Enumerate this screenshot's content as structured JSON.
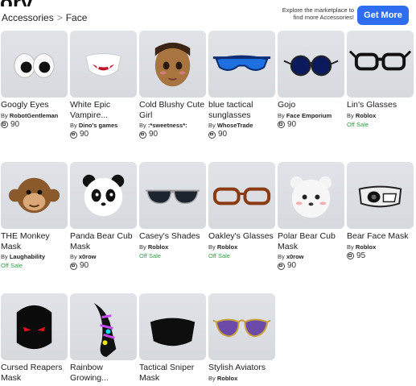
{
  "page": {
    "title_fragment": "ory",
    "breadcrumb": [
      "Accessories",
      "Face"
    ],
    "breadcrumb_separator": ">",
    "promo_text": "Explore the marketplace to find more Accessories!",
    "get_more_label": "Get More"
  },
  "items": [
    {
      "name": "Googly Eyes",
      "by": "By",
      "creator": "RobotGentleman",
      "price": "90",
      "offsale": "",
      "icon": "googly-eyes-icon"
    },
    {
      "name": "White Epic Vampire...",
      "by": "By",
      "creator": "Dino's games",
      "price": "90",
      "offsale": "",
      "icon": "vampire-mask-icon"
    },
    {
      "name": "Cold Blushy Cute Girl",
      "by": "By",
      "creator": ":*sweetness*:",
      "price": "90",
      "offsale": "",
      "icon": "girl-face-icon"
    },
    {
      "name": "blue tactical sunglasses",
      "by": "By",
      "creator": "WhoseTrade",
      "price": "90",
      "offsale": "",
      "icon": "blue-sunglasses-icon"
    },
    {
      "name": "Gojo",
      "by": "By",
      "creator": "Face Emporium",
      "price": "90",
      "offsale": "",
      "icon": "round-glasses-icon"
    },
    {
      "name": "Lin's Glasses",
      "by": "By",
      "creator": "Roblox",
      "price": "",
      "offsale": "Off Sale",
      "icon": "black-glasses-icon"
    },
    {
      "name": "THE Monkey Mask",
      "by": "By",
      "creator": "Laughability",
      "price": "",
      "offsale": "Off Sale",
      "icon": "monkey-mask-icon"
    },
    {
      "name": "Panda Bear Cub Mask",
      "by": "By",
      "creator": "x0row",
      "price": "90",
      "offsale": "",
      "icon": "panda-mask-icon"
    },
    {
      "name": "Casey's Shades",
      "by": "By",
      "creator": "Roblox",
      "price": "",
      "offsale": "Off Sale",
      "icon": "shades-icon"
    },
    {
      "name": "Oakley's Glasses",
      "by": "By",
      "creator": "Roblox",
      "price": "",
      "offsale": "Off Sale",
      "icon": "brown-glasses-icon"
    },
    {
      "name": "Polar Bear Cub Mask",
      "by": "By",
      "creator": "x0row",
      "price": "90",
      "offsale": "",
      "icon": "polar-bear-mask-icon"
    },
    {
      "name": "Bear Face Mask",
      "by": "By",
      "creator": "Roblox",
      "price": "95",
      "offsale": "",
      "icon": "bear-face-mask-icon"
    },
    {
      "name": "Cursed Reapers Mask",
      "by": "",
      "creator": "",
      "price": "",
      "offsale": "",
      "icon": "reaper-mask-icon"
    },
    {
      "name": "Rainbow Growing...",
      "by": "",
      "creator": "",
      "price": "",
      "offsale": "",
      "icon": "rainbow-mask-icon"
    },
    {
      "name": "Tactical Sniper Mask",
      "by": "",
      "creator": "",
      "price": "",
      "offsale": "",
      "icon": "sniper-mask-icon"
    },
    {
      "name": "Stylish Aviators",
      "by": "By",
      "creator": "Roblox",
      "price": "",
      "offsale": "",
      "icon": "aviators-icon"
    }
  ]
}
